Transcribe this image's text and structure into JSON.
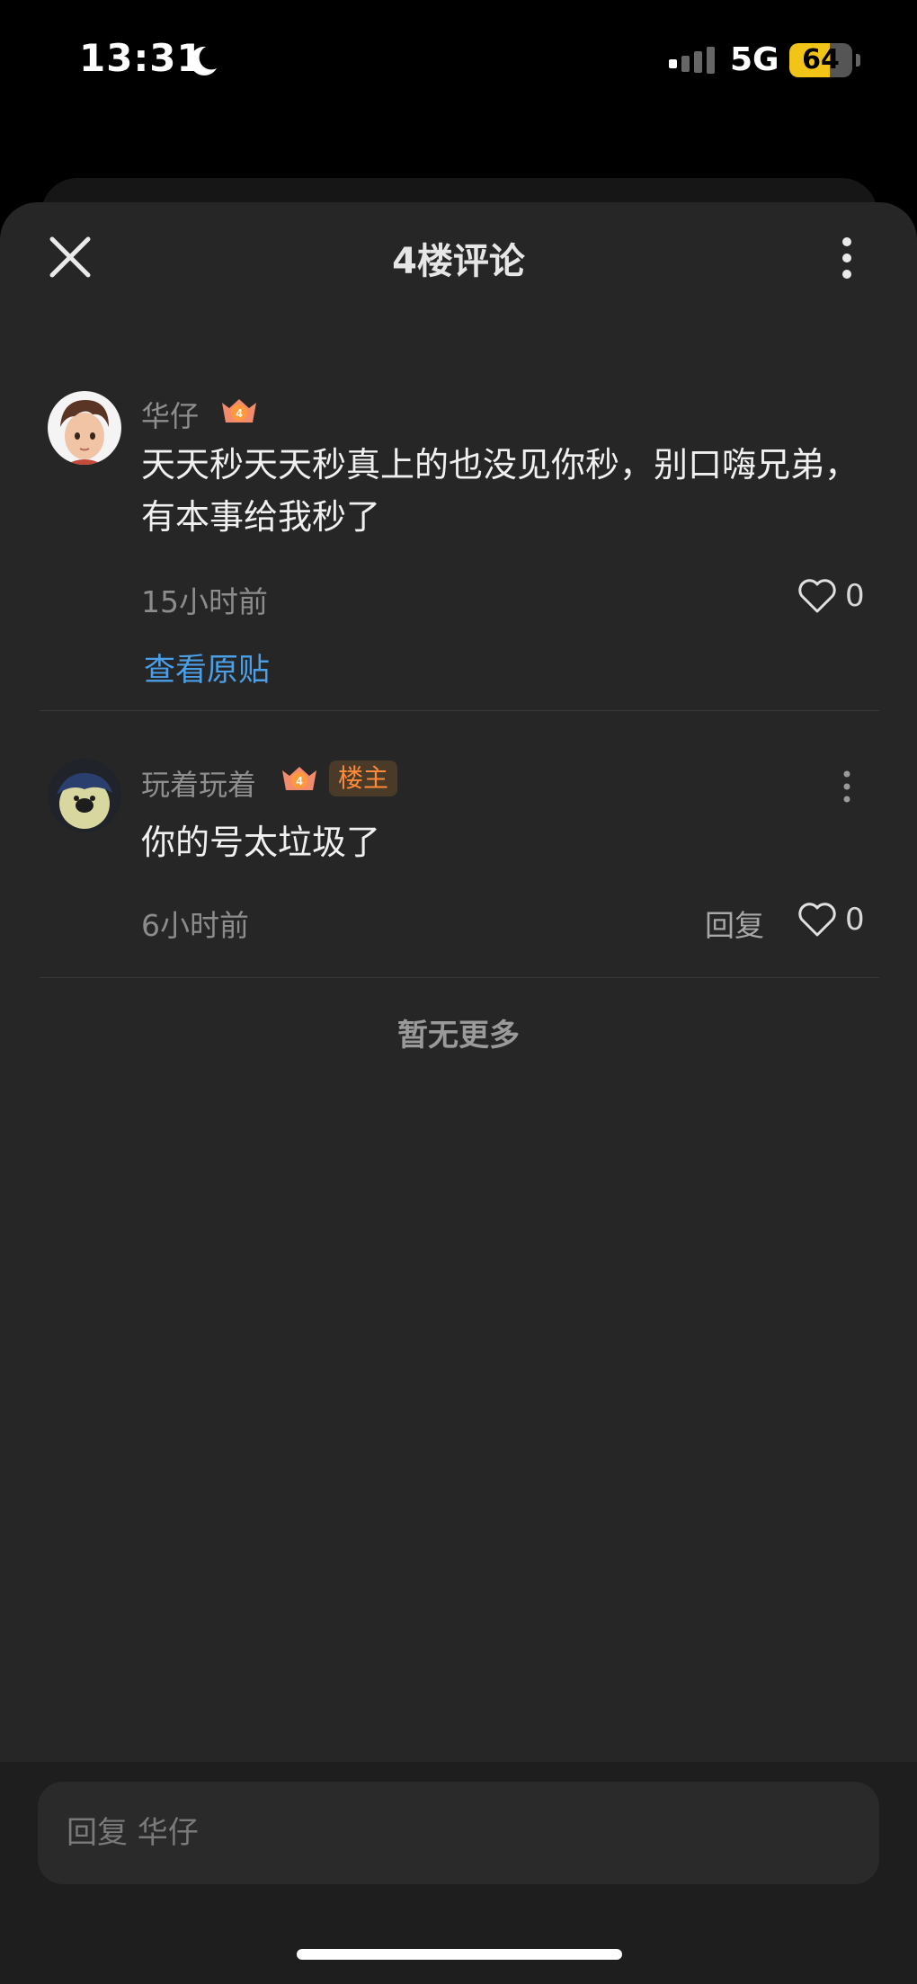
{
  "status": {
    "time": "13:31",
    "network": "5G",
    "battery": "64",
    "battery_level": 0.64
  },
  "header": {
    "title": "4楼评论"
  },
  "comments": [
    {
      "name": "华仔",
      "level": "4",
      "text": "天天秒天天秒真上的也没见你秒，别口嗨兄弟，有本事给我秒了",
      "time": "15小时前",
      "likes": "0",
      "view_post": "查看原贴"
    },
    {
      "name": "玩着玩着",
      "level": "4",
      "badge": "楼主",
      "text": "你的号太垃圾了",
      "time": "6小时前",
      "reply": "回复",
      "likes": "0"
    }
  ],
  "footer_note": "暂无更多",
  "reply_input": {
    "placeholder": "回复 华仔"
  },
  "colors": {
    "link": "#4a9fe6",
    "op_badge": "#ff8a3a",
    "battery": "#f3c418",
    "sheet_bg": "#262626"
  }
}
